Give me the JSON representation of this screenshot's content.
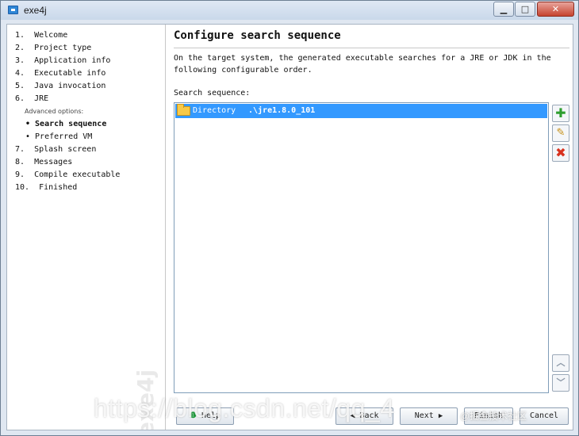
{
  "window": {
    "title": "exe4j",
    "min_label": "▁",
    "max_label": "□",
    "close_label": "✕"
  },
  "sidebar": {
    "steps": [
      {
        "label": "1.  Welcome"
      },
      {
        "label": "2.  Project type"
      },
      {
        "label": "3.  Application info"
      },
      {
        "label": "4.  Executable info"
      },
      {
        "label": "5.  Java invocation"
      },
      {
        "label": "6.  JRE"
      }
    ],
    "advanced_label": "Advanced options:",
    "sub_steps": [
      {
        "label": "• Search sequence",
        "current": true
      },
      {
        "label": "• Preferred VM",
        "current": false
      }
    ],
    "steps_after": [
      {
        "label": "7.  Splash screen"
      },
      {
        "label": "8.  Messages"
      },
      {
        "label": "9.  Compile executable"
      },
      {
        "label": "10.  Finished"
      }
    ],
    "watermark": "exe4j"
  },
  "main": {
    "title": "Configure search sequence",
    "description": "On the target system, the generated executable searches for a JRE or JDK in the following configurable order.",
    "seq_label": "Search sequence:",
    "entries": [
      {
        "type": "Directory",
        "path": ".\\jre1.8.0_101",
        "selected": true
      }
    ],
    "side_buttons": {
      "add": "✚",
      "edit": "✎",
      "remove": "✖",
      "up": "︿",
      "down": "﹀"
    }
  },
  "footer": {
    "help_glyph": "❶",
    "help": "Help",
    "back": "◀ Back",
    "next": "Next",
    "next_arrow": "▶",
    "finish": "Finish",
    "cancel": "Cancel"
  },
  "overlay": {
    "watermark": "https://blog.csdn.net/qq_4",
    "watermark_small": "@掘金技术社区"
  }
}
